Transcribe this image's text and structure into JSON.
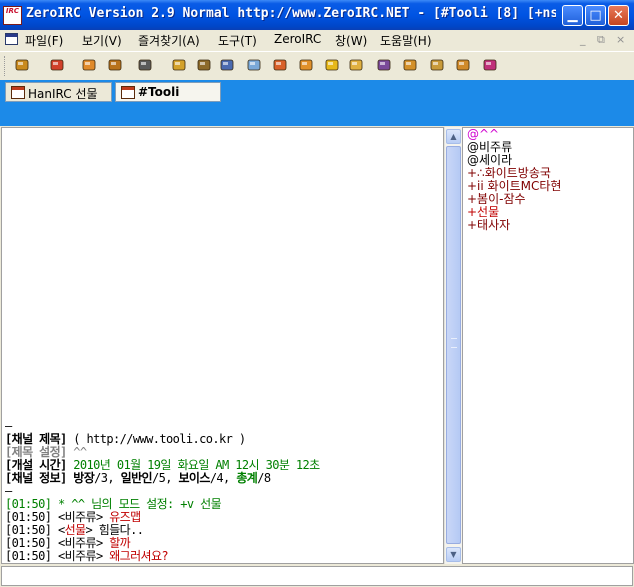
{
  "window": {
    "title": "ZeroIRC Version 2.9 Normal http://www.ZeroIRC.NET - [#Tooli [8] [+nst...",
    "app_icon_text": "IRC"
  },
  "menu": {
    "items": [
      "파일(F)",
      "보기(V)",
      "즐겨찾기(A)",
      "도구(T)",
      "ZeroIRC",
      "창(W)",
      "도움말(H)"
    ],
    "mdi": [
      "_",
      "⧉",
      "×"
    ]
  },
  "toolbar": {
    "buttons": [
      "connect-icon",
      "disconnect-icon",
      "favorites-icon",
      "join-icon",
      "edit-icon",
      "options-icon",
      "timer-icon",
      "copy-icon",
      "log-icon",
      "dcc-send-icon",
      "dcc-chat-icon",
      "notify-icon",
      "folder-icon",
      "away-icon",
      "color-icon",
      "tile-horizontal-icon",
      "cascade-icon",
      "about-icon"
    ],
    "colors": [
      "#c98a1e",
      "#d0402a",
      "#e08a2a",
      "#b8721c",
      "#5a5a5a",
      "#d3a12a",
      "#8c6a2a",
      "#4a6ab0",
      "#7aa8d8",
      "#d8602a",
      "#e0902a",
      "#e6b81a",
      "#e0b040",
      "#7a4a9a",
      "#d3902a",
      "#c89a3a",
      "#d08a2a",
      "#c0307a"
    ]
  },
  "tabs": [
    {
      "label": "HanIRC 선물",
      "active": false
    },
    {
      "label": "#Tooli",
      "active": true
    }
  ],
  "chat": {
    "lines": [
      {
        "parts": [
          {
            "t": "–",
            "c": "#000000",
            "b": false
          }
        ]
      },
      {
        "parts": [
          {
            "t": "[채널 제목] ",
            "c": "#000000",
            "b": true
          },
          {
            "t": "( http://www.tooli.co.kr )",
            "c": "#000000",
            "b": false
          }
        ]
      },
      {
        "parts": [
          {
            "t": "[제목 설정] ",
            "c": "#808080",
            "b": true
          },
          {
            "t": "^^",
            "c": "#808080",
            "b": false
          }
        ]
      },
      {
        "parts": [
          {
            "t": "[개설 시간] ",
            "c": "#000000",
            "b": true
          },
          {
            "t": "2010년 01월 19일 화요일 AM 12시 30분 12초",
            "c": "#008000",
            "b": false
          }
        ]
      },
      {
        "parts": [
          {
            "t": "[채널 정보] ",
            "c": "#000000",
            "b": true
          },
          {
            "t": "방장",
            "c": "#000000",
            "b": true
          },
          {
            "t": "/3, ",
            "c": "#000000",
            "b": false
          },
          {
            "t": "일반인",
            "c": "#000000",
            "b": true
          },
          {
            "t": "/5, ",
            "c": "#000000",
            "b": false
          },
          {
            "t": "보이스",
            "c": "#000000",
            "b": true
          },
          {
            "t": "/4, ",
            "c": "#000000",
            "b": false
          },
          {
            "t": "총계",
            "c": "#008000",
            "b": true
          },
          {
            "t": "/8",
            "c": "#000000",
            "b": false
          }
        ]
      },
      {
        "parts": [
          {
            "t": "–",
            "c": "#000000",
            "b": false
          }
        ]
      },
      {
        "parts": [
          {
            "t": "[01:50] * ^^ 님의 모드 설정: +v 선물",
            "c": "#008000",
            "b": false
          }
        ]
      },
      {
        "parts": [
          {
            "t": "[01:50] <",
            "c": "#000000",
            "b": false
          },
          {
            "t": "비주류",
            "c": "#000000",
            "b": false
          },
          {
            "t": ">  ",
            "c": "#000000",
            "b": false
          },
          {
            "t": "유즈맵",
            "c": "#c00000",
            "b": false
          }
        ]
      },
      {
        "parts": [
          {
            "t": "[01:50] <",
            "c": "#000000",
            "b": false
          },
          {
            "t": "선물",
            "c": "#c00000",
            "b": false
          },
          {
            "t": "> 힘들다..",
            "c": "#000000",
            "b": false
          }
        ]
      },
      {
        "parts": [
          {
            "t": "[01:50] <",
            "c": "#000000",
            "b": false
          },
          {
            "t": "비주류",
            "c": "#000000",
            "b": false
          },
          {
            "t": ">  ",
            "c": "#000000",
            "b": false
          },
          {
            "t": "할까",
            "c": "#c00000",
            "b": false
          }
        ]
      },
      {
        "parts": [
          {
            "t": "[01:50] <",
            "c": "#000000",
            "b": false
          },
          {
            "t": "비주류",
            "c": "#000000",
            "b": false
          },
          {
            "t": ">  ",
            "c": "#000000",
            "b": false
          },
          {
            "t": "왜그러셔요?",
            "c": "#c00000",
            "b": false
          }
        ]
      }
    ]
  },
  "nicks": [
    {
      "text": "@^^",
      "c": "#d000d0"
    },
    {
      "text": "@비주류",
      "c": "#000000"
    },
    {
      "text": "@세이라",
      "c": "#000000"
    },
    {
      "text": "+∴화이트방송국",
      "c": "#800000"
    },
    {
      "text": "+ii 화이트MC타현",
      "c": "#800000"
    },
    {
      "text": "+봄이-잠수",
      "c": "#800000"
    },
    {
      "text": "+선물",
      "c": "#c00000"
    },
    {
      "text": "+태사자",
      "c": "#800000"
    }
  ],
  "input": {
    "value": ""
  },
  "scroll": {
    "up": "▲",
    "down": "▼"
  }
}
